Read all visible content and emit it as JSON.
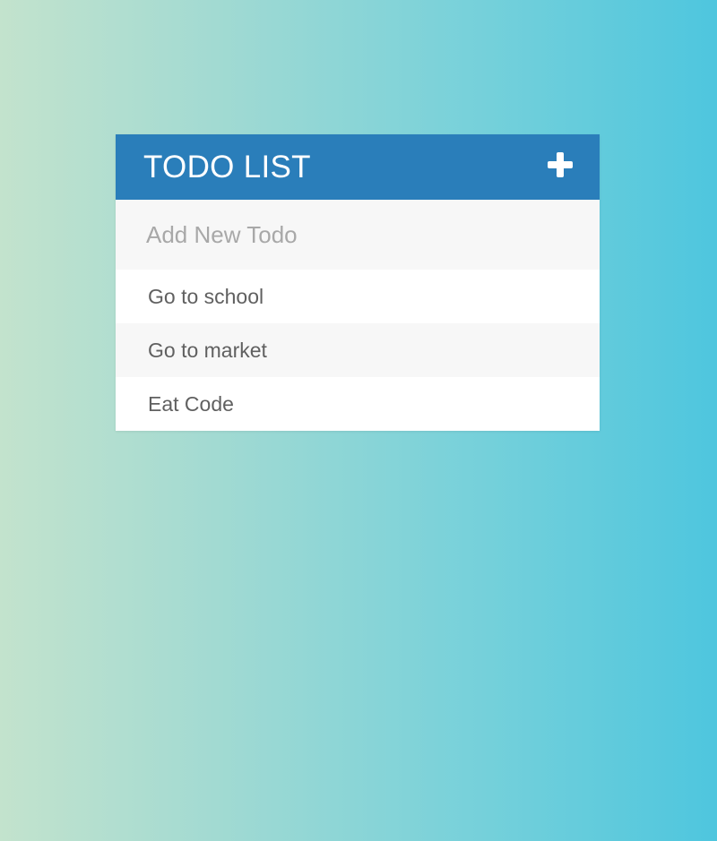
{
  "header": {
    "title": "TODO LIST",
    "add_icon": "plus-icon"
  },
  "input": {
    "placeholder": "Add New Todo",
    "value": ""
  },
  "todos": [
    {
      "label": "Go to school"
    },
    {
      "label": "Go to market"
    },
    {
      "label": "Eat Code"
    }
  ],
  "colors": {
    "header_bg": "#2a7eba",
    "input_bg": "#f7f7f7",
    "gradient_start": "#c3e3cd",
    "gradient_end": "#4ec6de"
  }
}
